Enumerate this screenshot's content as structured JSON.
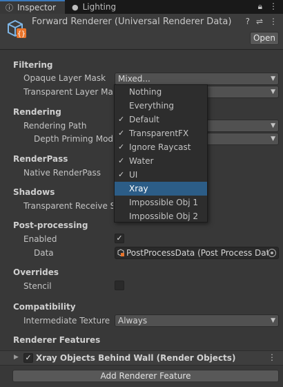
{
  "tabs": [
    {
      "label": "Inspector",
      "icon": "info-icon"
    },
    {
      "label": "Lighting",
      "icon": "light-bulb-icon"
    }
  ],
  "header": {
    "title": "Forward Renderer (Universal Renderer Data)",
    "open_label": "Open"
  },
  "sections": {
    "filtering": "Filtering",
    "rendering": "Rendering",
    "renderpass": "RenderPass",
    "shadows": "Shadows",
    "postprocessing": "Post-processing",
    "overrides": "Overrides",
    "compatibility": "Compatibility",
    "renderer_features": "Renderer Features"
  },
  "fields": {
    "opaque_layer_mask": {
      "label": "Opaque Layer Mask",
      "value": "Mixed..."
    },
    "transparent_layer_mask": {
      "label": "Transparent Layer Mas"
    },
    "rendering_path": {
      "label": "Rendering Path"
    },
    "depth_priming_mode": {
      "label": "Depth Priming Mode"
    },
    "native_renderpass": {
      "label": "Native RenderPass"
    },
    "transparent_receive_shadows": {
      "label": "Transparent Receive S"
    },
    "pp_enabled": {
      "label": "Enabled",
      "checked": true
    },
    "pp_data": {
      "label": "Data",
      "value": "PostProcessData (Post Process Data"
    },
    "stencil": {
      "label": "Stencil",
      "checked": false
    },
    "intermediate_texture": {
      "label": "Intermediate Texture",
      "value": "Always"
    }
  },
  "layer_dropdown": {
    "items": [
      {
        "label": "Nothing",
        "checked": false
      },
      {
        "label": "Everything",
        "checked": false
      },
      {
        "label": "Default",
        "checked": true
      },
      {
        "label": "TransparentFX",
        "checked": true
      },
      {
        "label": "Ignore Raycast",
        "checked": true
      },
      {
        "label": "Water",
        "checked": true
      },
      {
        "label": "UI",
        "checked": true
      },
      {
        "label": "Xray",
        "checked": false,
        "highlighted": true
      },
      {
        "label": "Impossible Obj 1",
        "checked": false
      },
      {
        "label": "Impossible Obj 2",
        "checked": false
      }
    ]
  },
  "renderer_features": [
    {
      "title": "Xray Objects Behind Wall (Render Objects)",
      "enabled": true
    }
  ],
  "add_feature_label": "Add Renderer Feature",
  "colors": {
    "background": "#383838",
    "accent": "#3a79bb",
    "selection": "#2c5d87"
  }
}
